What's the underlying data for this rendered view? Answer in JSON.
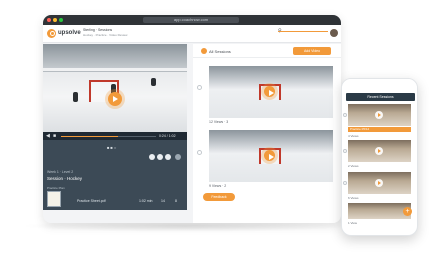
{
  "app": {
    "browser_url": "app.coachnow.com",
    "logo_text": "upsolve",
    "header_title": "Sterling · Sessions",
    "header_sub": "Hockey · Practice · Video Review",
    "brand_color": "#f29a3a"
  },
  "video": {
    "time": "0:24 / 1:02",
    "progress": 0.6
  },
  "panel": {
    "meta": "Week 1 · Level 2",
    "title": "Session · Hockey",
    "doc_label": "Practice Plan",
    "doc_name": "Practice Sheet.pdf",
    "stats": [
      "1:02 min",
      "14",
      "8"
    ]
  },
  "feed": {
    "label": "All Sessions",
    "add_button": "Add Video",
    "cards": [
      {
        "meta": "12 Views  ·  3"
      },
      {
        "meta": "9 Views  ·  2"
      }
    ],
    "feedback_button": "Feedback"
  },
  "phone": {
    "header": "Recent Sessions",
    "banner": "Practice 05/12",
    "cards_meta": [
      "4 Views",
      "2 Views",
      "6 Views",
      "1 View"
    ]
  }
}
